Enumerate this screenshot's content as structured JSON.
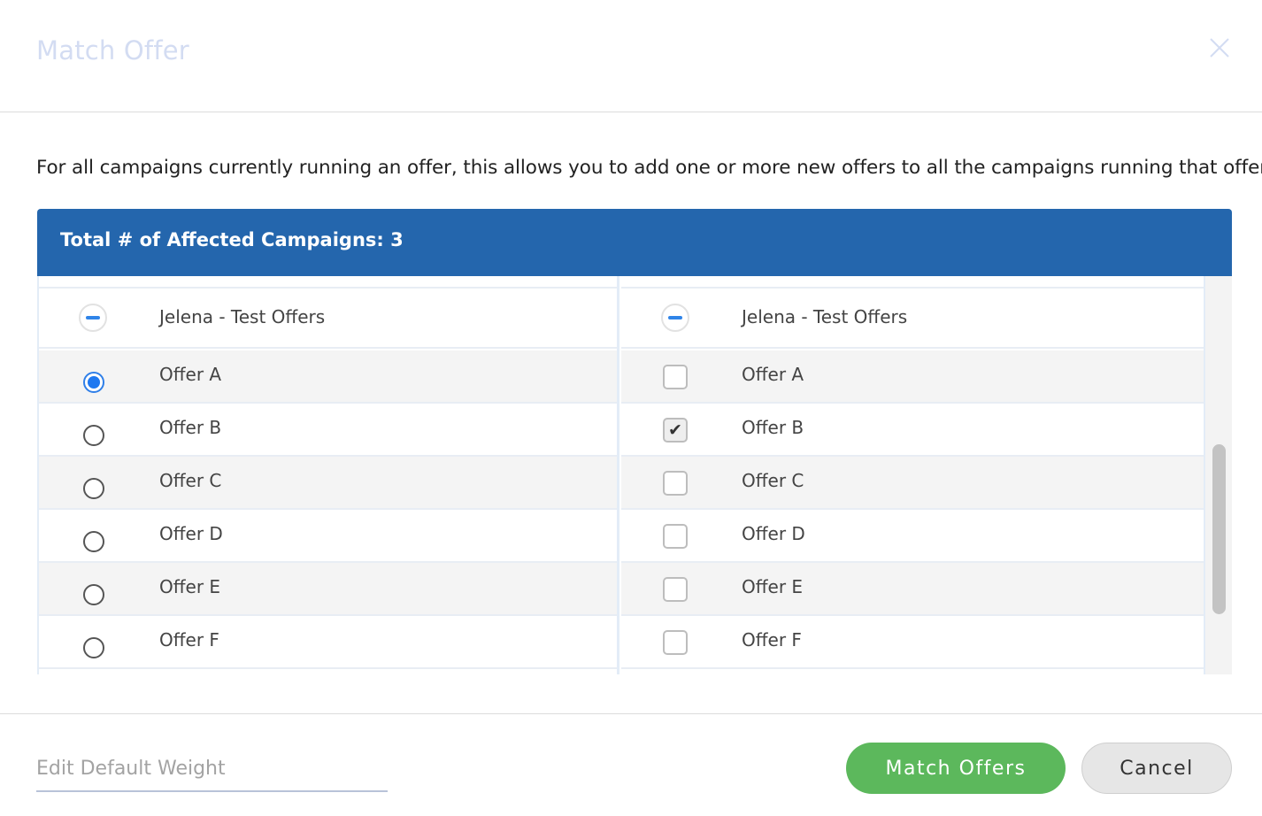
{
  "modal": {
    "title": "Match Offer",
    "close_icon": "close-icon"
  },
  "description": "For all campaigns currently running an offer, this allows you to add one or more new offers to all the campaigns running that offer.",
  "panel": {
    "header": "Total # of Affected Campaigns: 3"
  },
  "left_list": {
    "group_label": "Jelena - Test Offers",
    "items": [
      {
        "label": "Offer A",
        "selected": true
      },
      {
        "label": "Offer B",
        "selected": false
      },
      {
        "label": "Offer C",
        "selected": false
      },
      {
        "label": "Offer D",
        "selected": false
      },
      {
        "label": "Offer E",
        "selected": false
      },
      {
        "label": "Offer F",
        "selected": false
      }
    ]
  },
  "right_list": {
    "group_label": "Jelena - Test Offers",
    "items": [
      {
        "label": "Offer A",
        "checked": false
      },
      {
        "label": "Offer B",
        "checked": true
      },
      {
        "label": "Offer C",
        "checked": false
      },
      {
        "label": "Offer D",
        "checked": false
      },
      {
        "label": "Offer E",
        "checked": false
      },
      {
        "label": "Offer F",
        "checked": false
      }
    ]
  },
  "footer": {
    "weight_placeholder": "Edit Default Weight",
    "weight_value": "",
    "match_label": "Match Offers",
    "cancel_label": "Cancel"
  },
  "colors": {
    "header_blue": "#2466ad",
    "match_green": "#5cb85c",
    "title_faded": "#d3dcf2",
    "radio_blue": "#1f78f0"
  }
}
